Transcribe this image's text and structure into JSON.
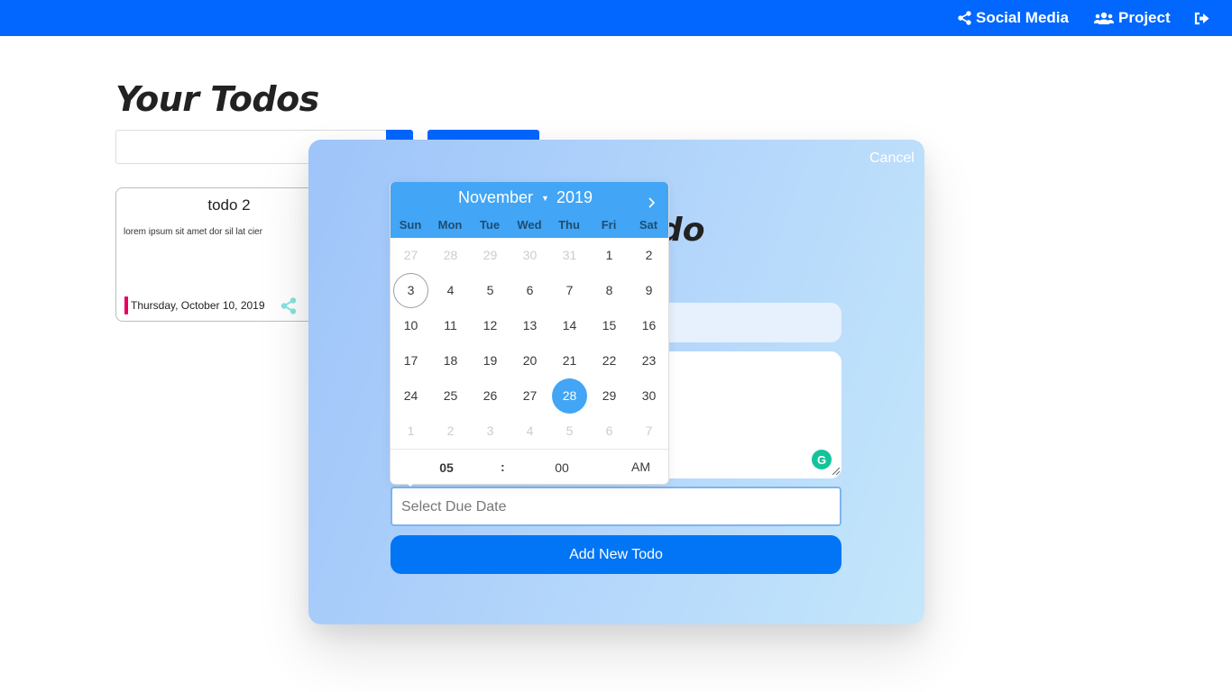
{
  "nav": {
    "social_label": "Social Media",
    "project_label": "Project"
  },
  "page": {
    "title": "Your Todos"
  },
  "todos": [
    {
      "title": "todo 2",
      "description": "lorem ipsum sit amet dor sil lat cier",
      "date": "Thursday, October 10, 2019"
    }
  ],
  "modal": {
    "cancel_label": "Cancel",
    "heading": "do",
    "due_placeholder": "Select Due Date",
    "add_button_label": "Add New Todo"
  },
  "datepicker": {
    "month": "November",
    "year": "2019",
    "weekdays": [
      "Sun",
      "Mon",
      "Tue",
      "Wed",
      "Thu",
      "Fri",
      "Sat"
    ],
    "weeks": [
      [
        "27",
        "28",
        "29",
        "30",
        "31",
        "1",
        "2"
      ],
      [
        "3",
        "4",
        "5",
        "6",
        "7",
        "8",
        "9"
      ],
      [
        "10",
        "11",
        "12",
        "13",
        "14",
        "15",
        "16"
      ],
      [
        "17",
        "18",
        "19",
        "20",
        "21",
        "22",
        "23"
      ],
      [
        "24",
        "25",
        "26",
        "27",
        "28",
        "29",
        "30"
      ],
      [
        "1",
        "2",
        "3",
        "4",
        "5",
        "6",
        "7"
      ]
    ],
    "today": "3",
    "selected": "28",
    "time": {
      "hour": "05",
      "separator": ":",
      "minute": "00",
      "ampm": "AM"
    }
  }
}
